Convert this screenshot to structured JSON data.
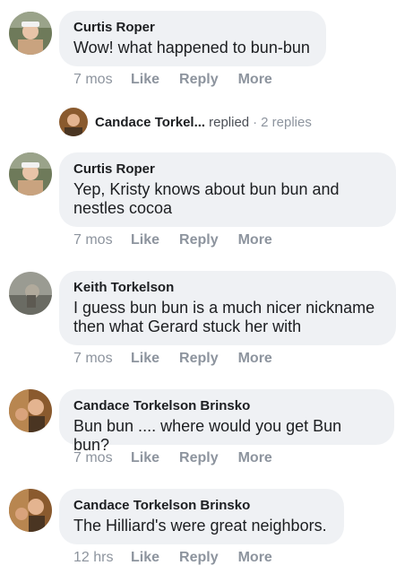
{
  "comments": [
    {
      "author": "Curtis Roper",
      "text": "Wow! what happened to bun-bun",
      "time": "7 mos",
      "like": "Like",
      "reply": "Reply",
      "more": "More"
    },
    {
      "author": "Curtis Roper",
      "text": "Yep, Kristy knows about bun bun and nestles cocoa",
      "time": "7 mos",
      "like": "Like",
      "reply": "Reply",
      "more": "More"
    },
    {
      "author": "Keith Torkelson",
      "text": "I guess bun bun is a much nicer nickname then what Gerard stuck her with",
      "time": "7 mos",
      "like": "Like",
      "reply": "Reply",
      "more": "More"
    },
    {
      "author": "Candace Torkelson Brinsko",
      "text": "Bun bun .... where would you get Bun bun?",
      "time": "7 mos",
      "like": "Like",
      "reply": "Reply",
      "more": "More"
    },
    {
      "author": "Candace Torkelson Brinsko",
      "text": "The Hilliard's were great neighbors.",
      "time": "12 hrs",
      "like": "Like",
      "reply": "Reply",
      "more": "More"
    }
  ],
  "reply_thread": {
    "name": "Candace Torkel...",
    "verb": "replied",
    "separator": "·",
    "count": "2 replies"
  }
}
